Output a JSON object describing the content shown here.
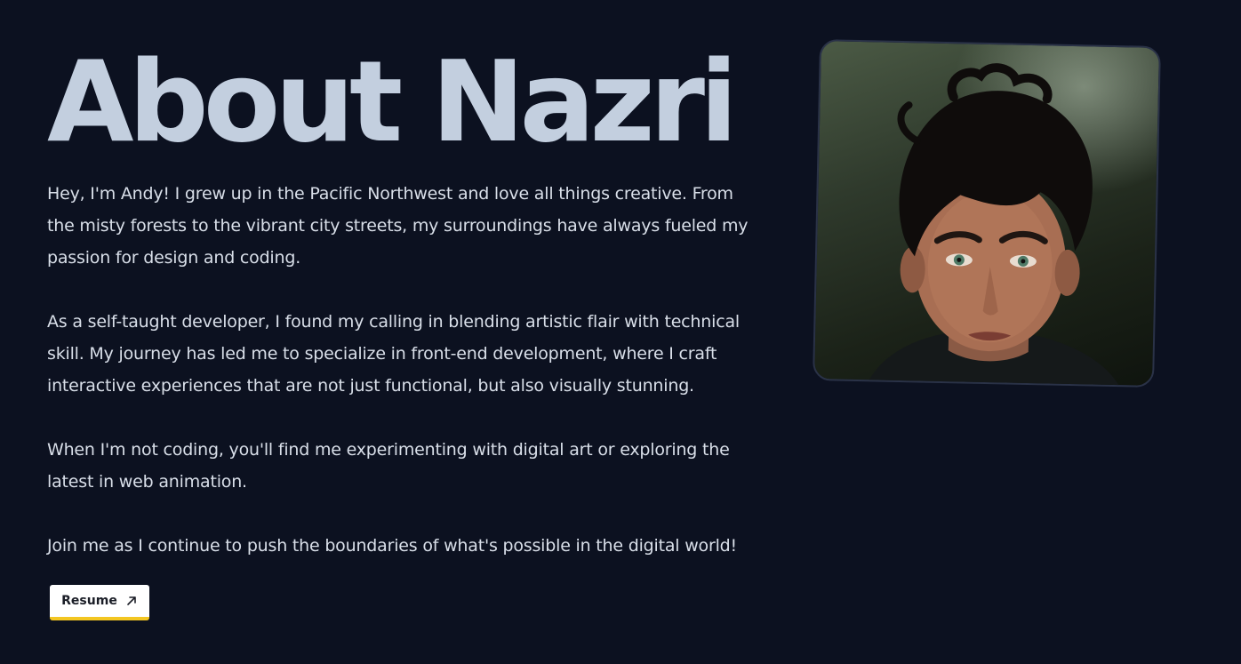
{
  "heading": "About Nazri",
  "bio": [
    "Hey, I'm Andy! I grew up in the Pacific Northwest and love all things creative. From the misty forests to the vibrant city streets, my surroundings have always fueled my passion for design and coding.",
    "As a self-taught developer, I found my calling in blending artistic flair with technical skill. My journey has led me to specialize in front-end development, where I craft interactive experiences that are not just functional, but also visually stunning.",
    "When I'm not coding, you'll find me experimenting with digital art or exploring the latest in web animation.",
    "Join me as I continue to push the boundaries of what's possible in the digital world!"
  ],
  "resume_button": {
    "label": "Resume",
    "icon": "arrow-up-right-icon"
  },
  "colors": {
    "background": "#0c1120",
    "heading": "#c3cfdf",
    "body_text": "#d9dfe9",
    "button_bg": "#ffffff",
    "button_accent": "#f3c622"
  }
}
